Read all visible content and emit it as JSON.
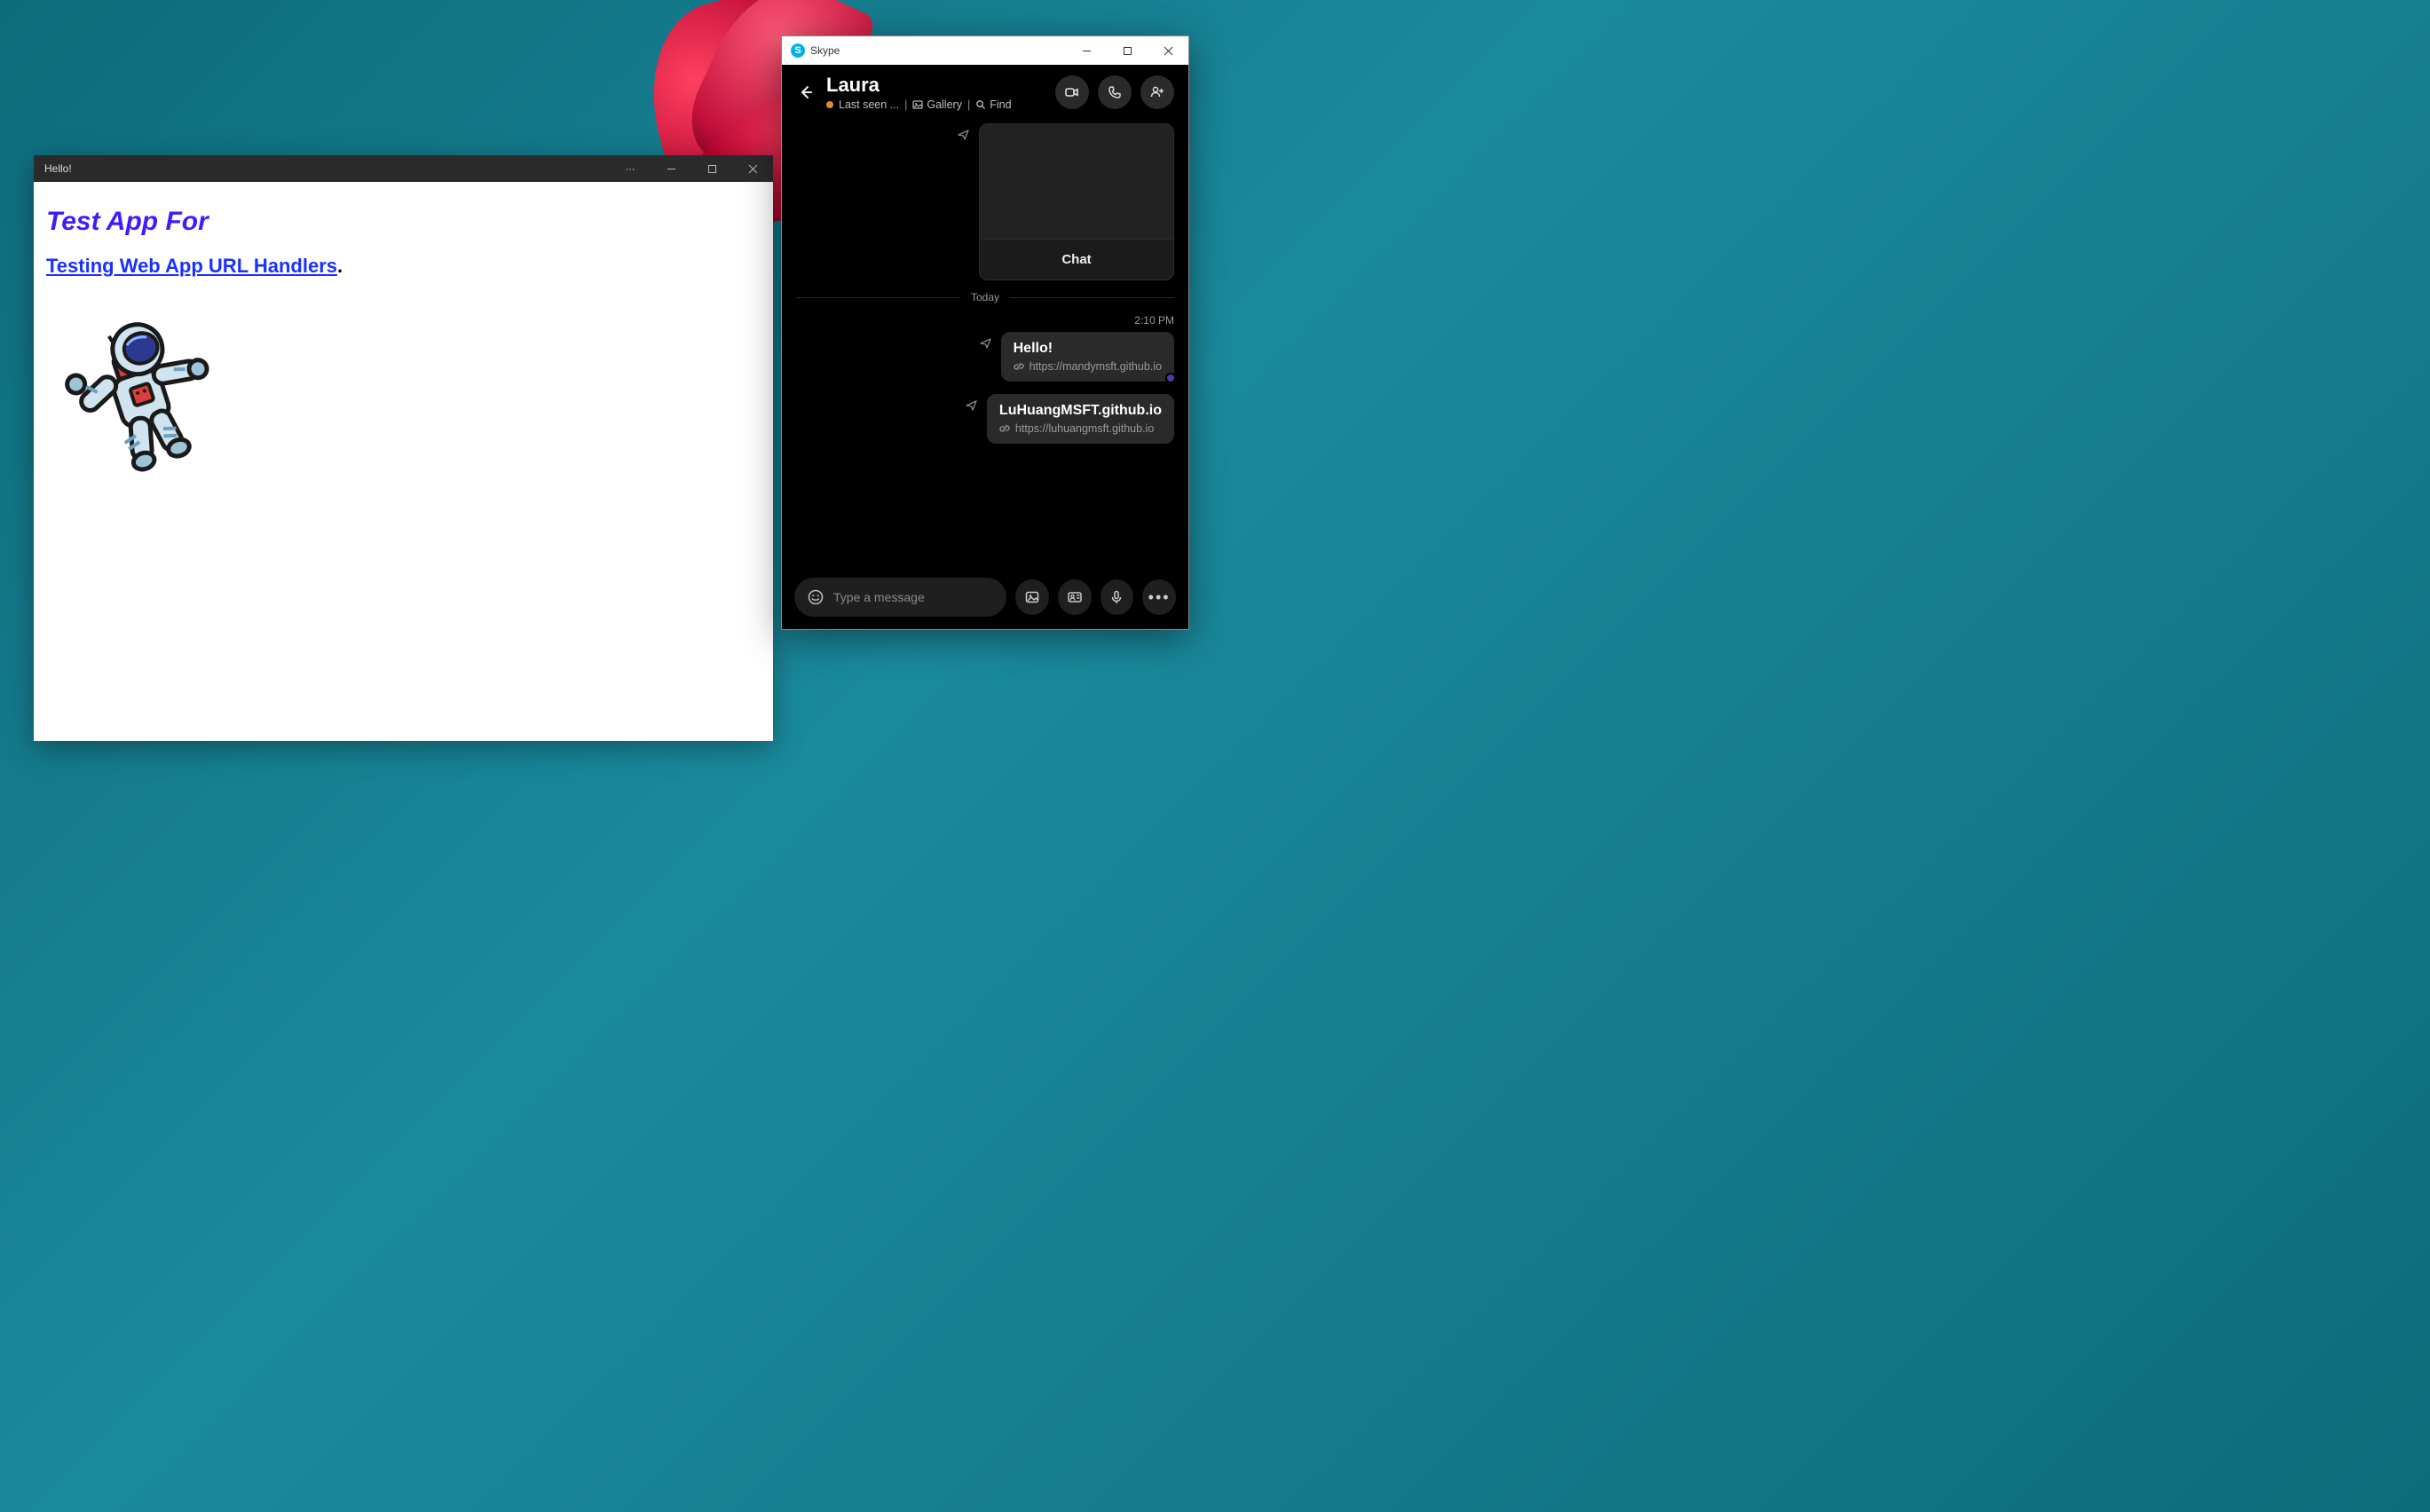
{
  "hello_window": {
    "title": "Hello!",
    "heading": "Test App For",
    "link_text": "Testing Web App URL Handlers",
    "link_suffix": "."
  },
  "skype_window": {
    "app_name": "Skype",
    "contact_name": "Laura",
    "status_text": "Last seen ...",
    "gallery_label": "Gallery",
    "find_label": "Find",
    "preview_card_label": "Chat",
    "day_divider": "Today",
    "time_stamp": "2:10 PM",
    "messages": [
      {
        "title": "Hello!",
        "url": "https://mandymsft.github.io",
        "has_read_indicator": true
      },
      {
        "title": "LuHuangMSFT.github.io",
        "url": "https://luhuangmsft.github.io",
        "has_read_indicator": false
      }
    ],
    "compose_placeholder": "Type a message"
  }
}
